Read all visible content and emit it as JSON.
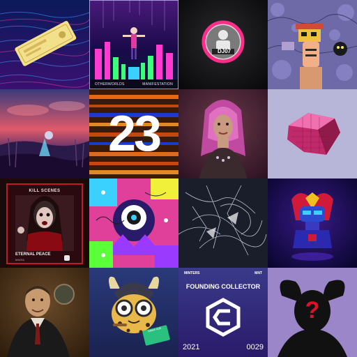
{
  "tiles": [
    {
      "name": "tile-ticket-on-waves"
    },
    {
      "name": "tile-neon-city-figure",
      "caption_left": "OTHERWORLDS",
      "caption_right": "MANIFESTATION"
    },
    {
      "name": "tile-dj-badge",
      "badge_text": "DJ07"
    },
    {
      "name": "tile-collage-character"
    },
    {
      "name": "tile-sunset-landscape"
    },
    {
      "name": "tile-number-23",
      "number": "23"
    },
    {
      "name": "tile-pink-hair-character"
    },
    {
      "name": "tile-pink-voxel-gem"
    },
    {
      "name": "tile-horror-card",
      "title_top": "KILL SCENES",
      "title_bottom": "ETERNAL PEACE",
      "subtitle": "MAGIA"
    },
    {
      "name": "tile-psychedelic-art"
    },
    {
      "name": "tile-sketch-lines"
    },
    {
      "name": "tile-robot-bust"
    },
    {
      "name": "tile-painted-portrait"
    },
    {
      "name": "tile-viking-cat-avatar",
      "card_text": "kattes club"
    },
    {
      "name": "tile-founding-collector",
      "brand_left": "MINTERS",
      "brand_right": "MNT",
      "title": "FOUNDING COLLECTOR",
      "year": "2021",
      "serial": "0029"
    },
    {
      "name": "tile-mystery-silhouette",
      "symbol": "?"
    }
  ],
  "colors": {
    "accent_pink": "#ff2d8a",
    "deep_purple": "#2a1060",
    "voxel_pink": "#e0408a"
  }
}
